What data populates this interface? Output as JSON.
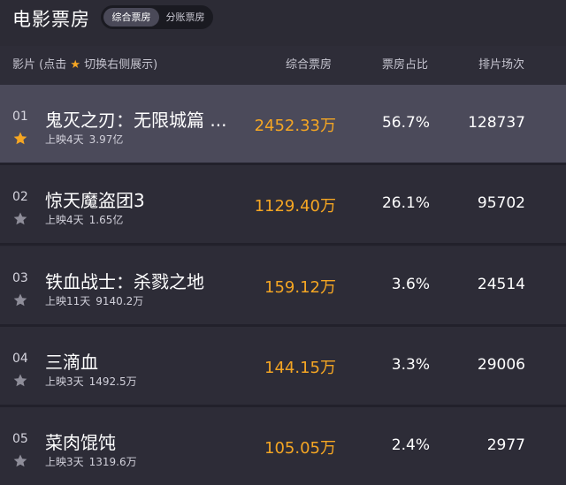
{
  "app": {
    "title": "电影票房",
    "tabs": [
      {
        "label": "综合票房",
        "active": true
      },
      {
        "label": "分账票房",
        "active": false
      }
    ]
  },
  "header": {
    "film_label_prefix": "影片 (点击",
    "film_label_suffix": "切换右侧展示)",
    "box_office": "综合票房",
    "share": "票房占比",
    "shows": "排片场次"
  },
  "colors": {
    "accent": "#f5a623",
    "star_inactive": "#8e8d99",
    "highlight_row": "#4b4a5a"
  },
  "movies": [
    {
      "rank": "01",
      "name": "鬼灭之刃：无限城篇 ...",
      "days": "上映4天",
      "total": "3.97亿",
      "box": "2452.33万",
      "share": "56.7%",
      "shows": "128737",
      "starred": true
    },
    {
      "rank": "02",
      "name": "惊天魔盗团3",
      "days": "上映4天",
      "total": "1.65亿",
      "box": "1129.40万",
      "share": "26.1%",
      "shows": "95702",
      "starred": false
    },
    {
      "rank": "03",
      "name": "铁血战士：杀戮之地",
      "days": "上映11天",
      "total": "9140.2万",
      "box": "159.12万",
      "share": "3.6%",
      "shows": "24514",
      "starred": false
    },
    {
      "rank": "04",
      "name": "三滴血",
      "days": "上映3天",
      "total": "1492.5万",
      "box": "144.15万",
      "share": "3.3%",
      "shows": "29006",
      "starred": false
    },
    {
      "rank": "05",
      "name": "菜肉馄饨",
      "days": "上映3天",
      "total": "1319.6万",
      "box": "105.05万",
      "share": "2.4%",
      "shows": "2977",
      "starred": false
    }
  ]
}
